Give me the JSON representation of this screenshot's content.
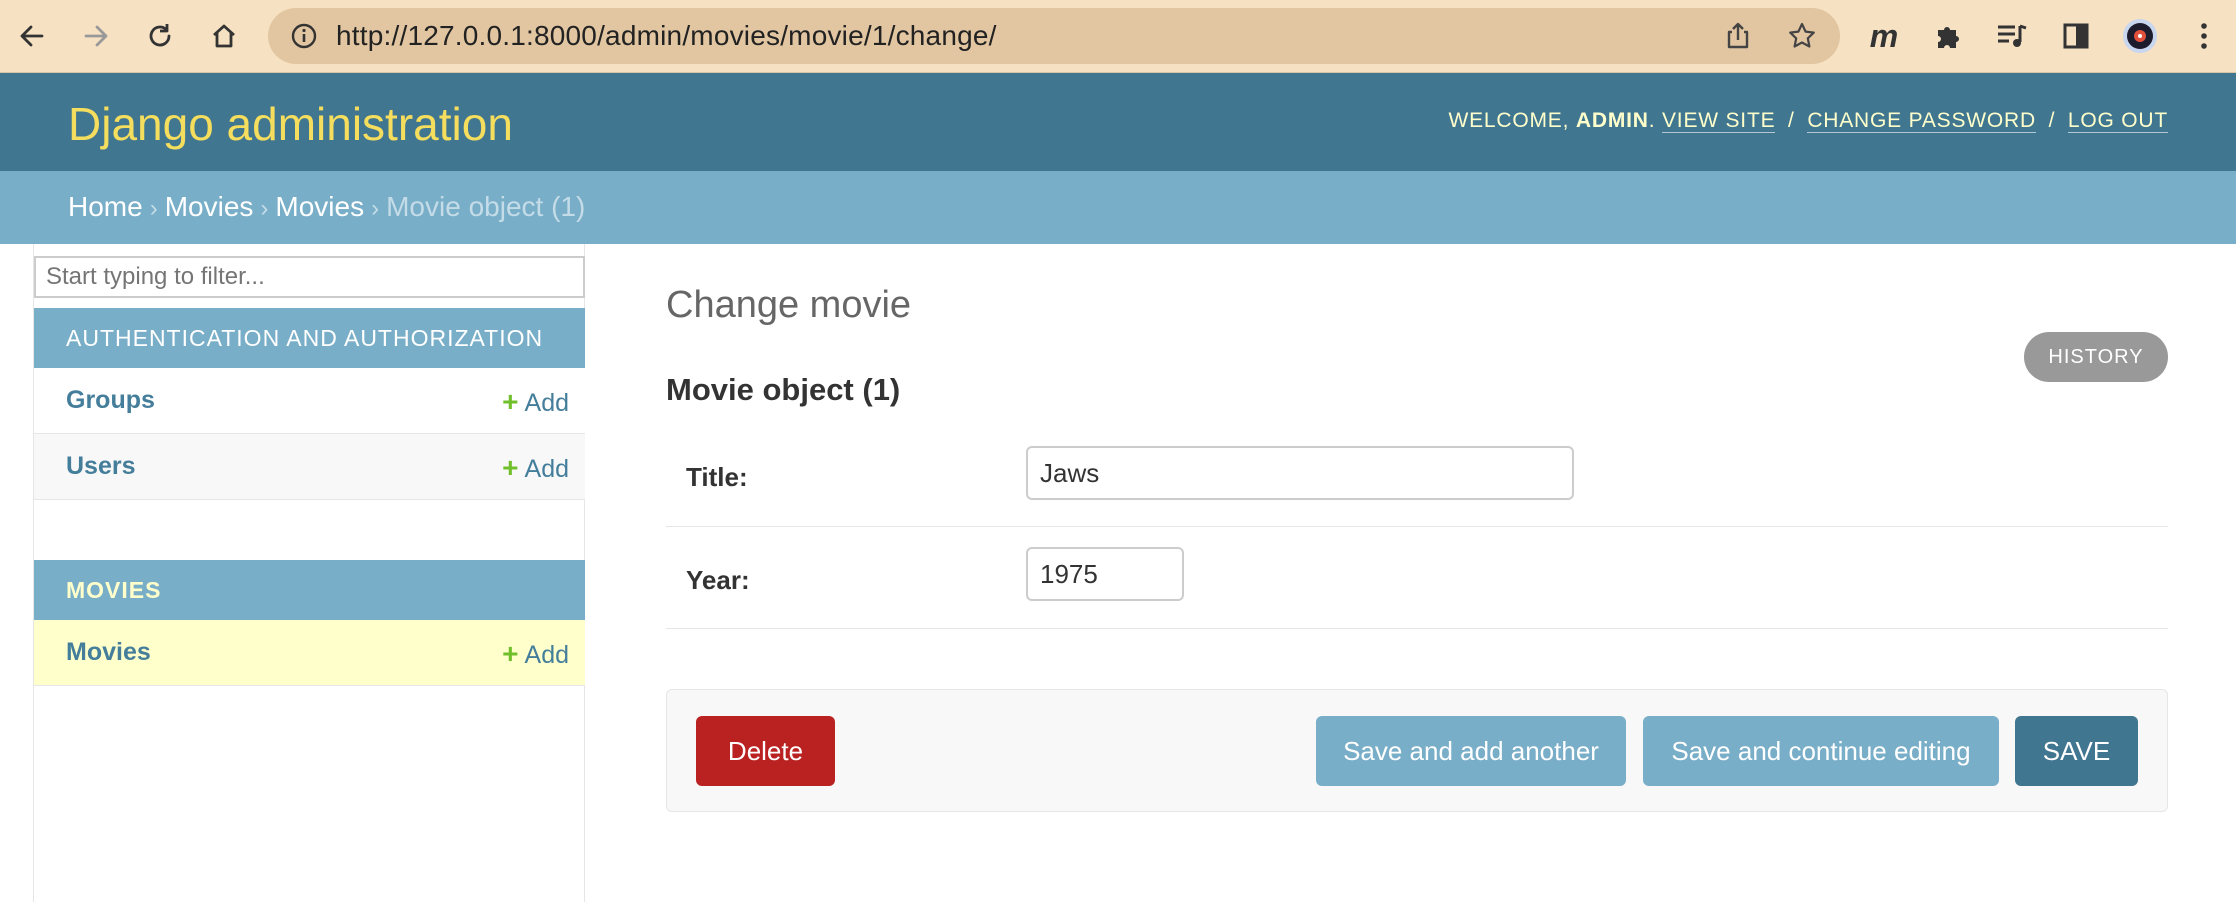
{
  "browser": {
    "url": "http://127.0.0.1:8000/admin/movies/movie/1/change/",
    "icons": [
      "back-icon",
      "forward-icon",
      "reload-icon",
      "home-icon",
      "info-icon",
      "share-icon",
      "star-icon",
      "m-extension-icon",
      "puzzle-icon",
      "media-icon",
      "sidepanel-icon",
      "profile-icon",
      "menu-icon"
    ]
  },
  "header": {
    "branding": "Django administration",
    "welcome": "WELCOME,",
    "username": "ADMIN",
    "period": ".",
    "view_site": "VIEW SITE",
    "change_password": "CHANGE PASSWORD",
    "log_out": "LOG OUT",
    "separator": "/"
  },
  "breadcrumbs": {
    "items": [
      "Home",
      "Movies",
      "Movies"
    ],
    "current": "Movie object (1)",
    "separator": "›"
  },
  "sidebar": {
    "filter_placeholder": "Start typing to filter...",
    "modules": [
      {
        "caption": "AUTHENTICATION AND AUTHORIZATION",
        "models": [
          {
            "name": "Groups",
            "add": "Add"
          },
          {
            "name": "Users",
            "add": "Add"
          }
        ]
      },
      {
        "caption": "MOVIES",
        "models": [
          {
            "name": "Movies",
            "add": "Add",
            "current": true
          }
        ]
      }
    ]
  },
  "content": {
    "title": "Change movie",
    "history": "HISTORY",
    "object_heading": "Movie object (1)",
    "fields": [
      {
        "label": "Title:",
        "value": "Jaws"
      },
      {
        "label": "Year:",
        "value": "1975"
      }
    ],
    "buttons": {
      "delete": "Delete",
      "save_add_another": "Save and add another",
      "save_continue": "Save and continue editing",
      "save": "SAVE"
    }
  },
  "colors": {
    "header": "#417690",
    "breadcrumbs": "#79aec8",
    "branding": "#f5dd5d",
    "delete": "#ba2121",
    "add_plus": "#70bf2b",
    "link": "#447e9b"
  }
}
